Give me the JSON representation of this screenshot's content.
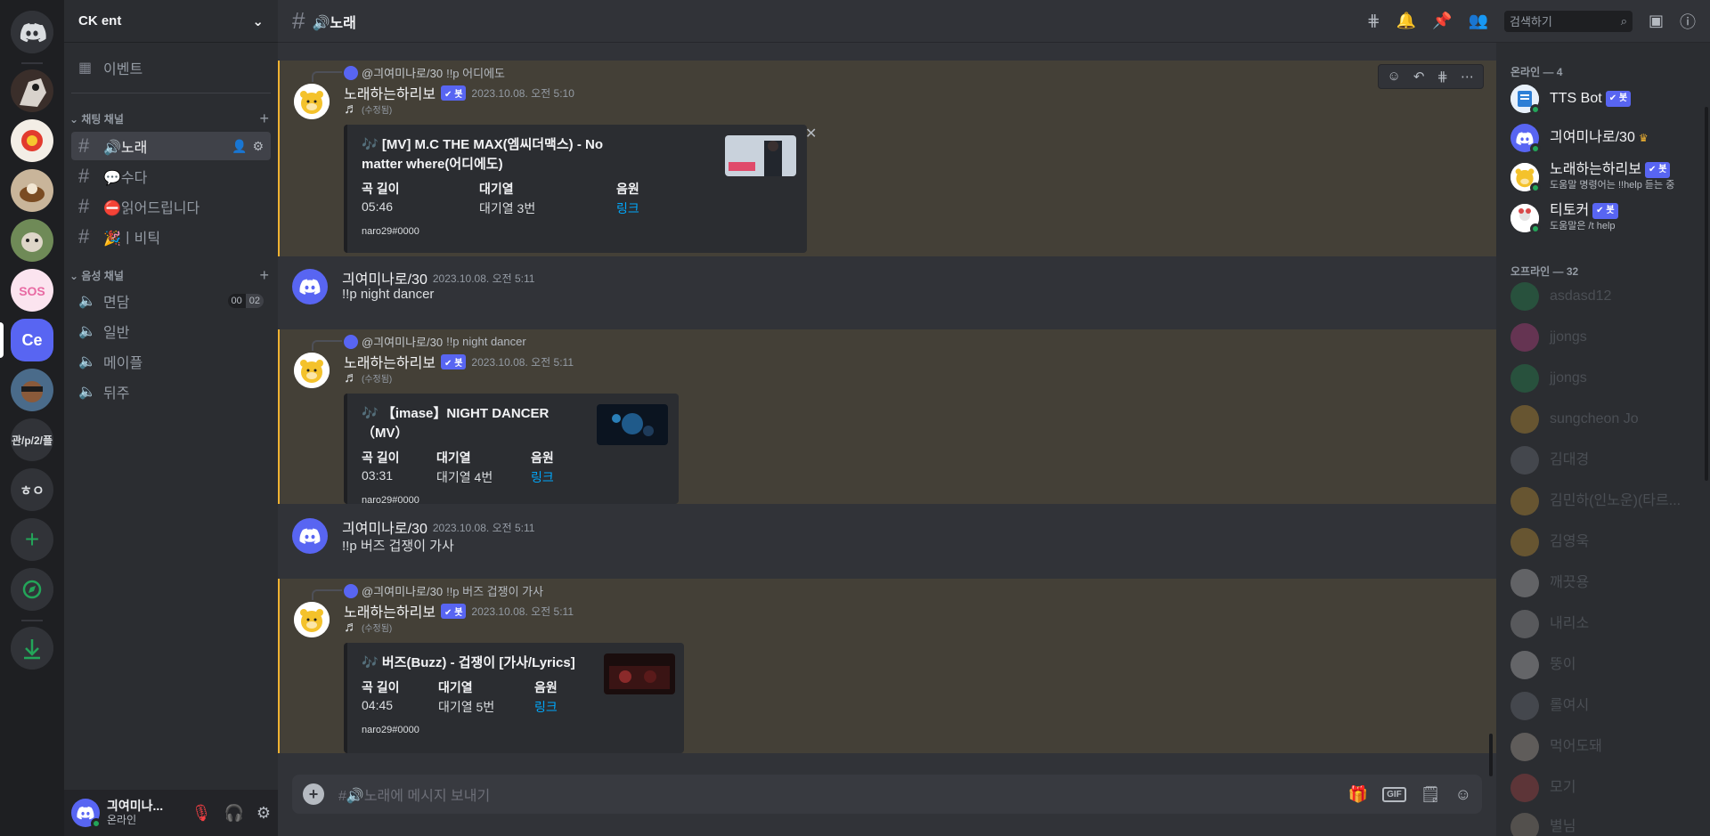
{
  "server": {
    "name": "CK ent"
  },
  "sidebar": {
    "events_label": "이벤트",
    "text_category": "채팅 채널",
    "voice_category": "음성 채널",
    "text_channels": [
      {
        "label": "🔊노래",
        "active": true
      },
      {
        "label": "💬수다",
        "active": false
      },
      {
        "label": "⛔읽어드립니다",
        "active": false
      },
      {
        "label": "🎉ㅣ비틱",
        "active": false
      }
    ],
    "voice_channels": [
      {
        "label": "면담",
        "count_a": "00",
        "count_b": "02"
      },
      {
        "label": "일반"
      },
      {
        "label": "메이플"
      },
      {
        "label": "뒤주"
      }
    ]
  },
  "guilds": [
    {
      "label": ""
    },
    {
      "label": ""
    },
    {
      "label": ""
    },
    {
      "label": ""
    },
    {
      "label": ""
    },
    {
      "label": "Ce"
    },
    {
      "label": ""
    },
    {
      "label": "관/p/2/플"
    },
    {
      "label": "ㅎㅇ"
    }
  ],
  "user": {
    "name": "긔여미나...",
    "status": "온라인"
  },
  "topbar": {
    "channel_title": "🔊노래",
    "search_placeholder": "검색하기"
  },
  "messages": [
    {
      "reply_user": "@긔여미나로/30",
      "reply_text": "!!p 어디에도",
      "author": "노래하는하리보",
      "bot_tag": "✔ 봇",
      "time": "2023.10.08. 오전 5:10",
      "note": "♬",
      "edited": "(수정됨)",
      "embed": {
        "title": "🎶 [MV] M.C THE MAX(엠씨더맥스) - No matter where(어디에도)",
        "length_key": "곡 길이",
        "length_val": "05:46",
        "queue_key": "대기열",
        "queue_val": "대기열 3번",
        "source_key": "음원",
        "source_val": "링크",
        "footer": "naro29#0000"
      }
    },
    {
      "author": "긔여미나로/30",
      "time": "2023.10.08. 오전 5:11",
      "text": "!!p night dancer"
    },
    {
      "reply_user": "@긔여미나로/30",
      "reply_text": "!!p night dancer",
      "author": "노래하는하리보",
      "bot_tag": "✔ 봇",
      "time": "2023.10.08. 오전 5:11",
      "note": "♬",
      "edited": "(수정됨)",
      "embed": {
        "title": "🎶 【imase】NIGHT DANCER（MV）",
        "length_key": "곡 길이",
        "length_val": "03:31",
        "queue_key": "대기열",
        "queue_val": "대기열 4번",
        "source_key": "음원",
        "source_val": "링크",
        "footer": "naro29#0000"
      }
    },
    {
      "author": "긔여미나로/30",
      "time": "2023.10.08. 오전 5:11",
      "text": "!!p 버즈 겁쟁이 가사"
    },
    {
      "reply_user": "@긔여미나로/30",
      "reply_text": "!!p 버즈 겁쟁이 가사",
      "author": "노래하는하리보",
      "bot_tag": "✔ 봇",
      "time": "2023.10.08. 오전 5:11",
      "note": "♬",
      "edited": "(수정됨)",
      "embed": {
        "title": "🎶 버즈(Buzz) - 겁쟁이 [가사/Lyrics]",
        "length_key": "곡 길이",
        "length_val": "04:45",
        "queue_key": "대기열",
        "queue_val": "대기열 5번",
        "source_key": "음원",
        "source_val": "링크",
        "footer": "naro29#0000"
      }
    }
  ],
  "composer": {
    "placeholder": "#🔊노래에 메시지 보내기",
    "gif_label": "GIF"
  },
  "members": {
    "online_header": "온라인 — 4",
    "offline_header": "오프라인 — 32",
    "online": [
      {
        "name": "TTS Bot",
        "tag": "✔ 봇",
        "sub": ""
      },
      {
        "name": "긔여미나로/30",
        "tag": "",
        "sub": ""
      },
      {
        "name": "노래하는하리보",
        "tag": "✔ 봇",
        "sub": "도움말 명령어는 !!help 듣는 중"
      },
      {
        "name": "티토커",
        "tag": "✔ 봇",
        "sub": "도움말은 /t help"
      }
    ],
    "offline": [
      {
        "name": "asdasd12"
      },
      {
        "name": "jjongs"
      },
      {
        "name": "jjongs"
      },
      {
        "name": "sungcheon Jo"
      },
      {
        "name": "김대경"
      },
      {
        "name": "김민하(인노운)(타르..."
      },
      {
        "name": "김영욱"
      },
      {
        "name": "깨끗용"
      },
      {
        "name": "내리소"
      },
      {
        "name": "뚱이"
      },
      {
        "name": "롤여시"
      },
      {
        "name": "먹어도돼"
      },
      {
        "name": "모기"
      },
      {
        "name": "별님"
      }
    ]
  },
  "colors": {
    "accent": "#5865f2",
    "online": "#23a559",
    "highlight": "#f0b232",
    "link": "#00a8fc"
  }
}
